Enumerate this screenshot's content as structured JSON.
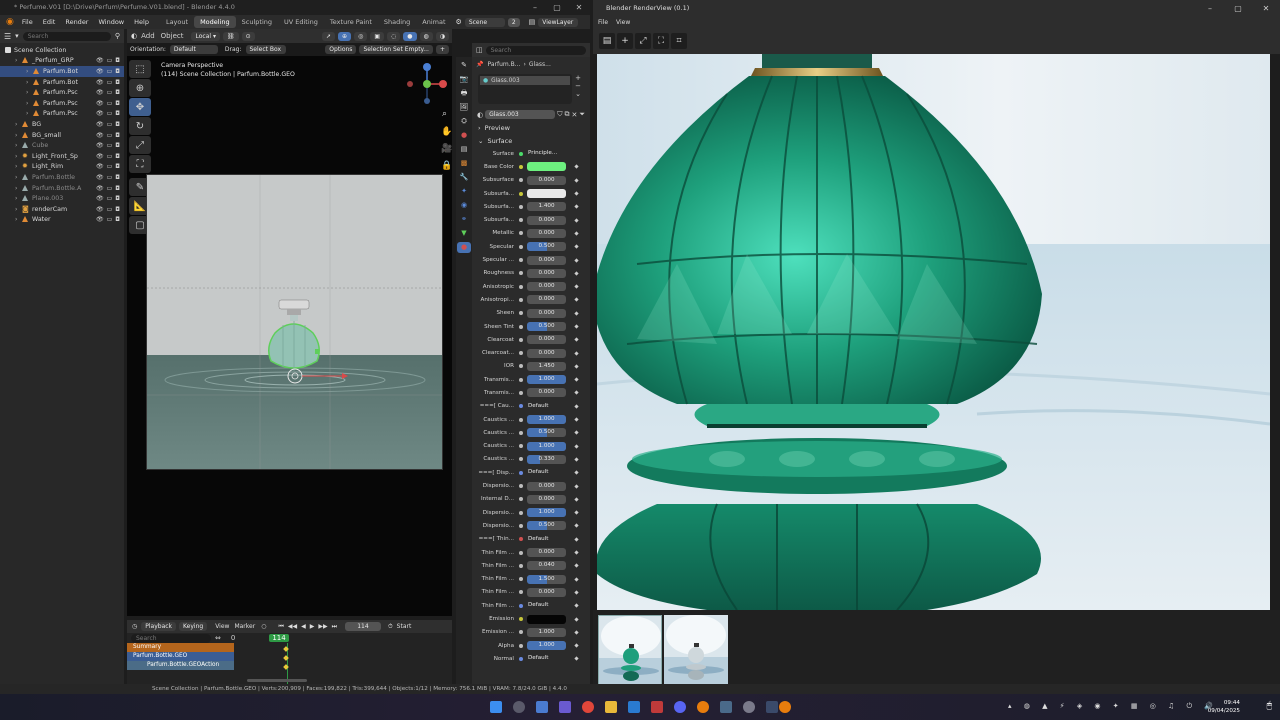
{
  "blender": {
    "title": "* Perfume.V01 [D:\\Drive\\Perfum\\Perfume.V01.blend] - Blender 4.4.0",
    "menus": [
      "File",
      "Edit",
      "Render",
      "Window",
      "Help"
    ],
    "workspaces": [
      "Layout",
      "Modeling",
      "Sculpting",
      "UV Editing",
      "Texture Paint",
      "Shading",
      "Animat"
    ],
    "active_workspace": "Modeling",
    "scene_label": "Scene",
    "view_layer_label": "ViewLayer",
    "scene_count": "2"
  },
  "outliner": {
    "search_placeholder": "Search",
    "root": "Scene Collection",
    "items": [
      {
        "label": "_Perfum_GRP",
        "indent": 1,
        "state": "normal",
        "icon": "empty"
      },
      {
        "label": "Parfum.Bot",
        "indent": 2,
        "state": "active",
        "icon": "mesh"
      },
      {
        "label": "Parfum.Bot",
        "indent": 2,
        "state": "normal",
        "icon": "mesh"
      },
      {
        "label": "Parfum.Psc",
        "indent": 2,
        "state": "normal",
        "icon": "mesh"
      },
      {
        "label": "Parfum.Psc",
        "indent": 2,
        "state": "normal",
        "icon": "mesh"
      },
      {
        "label": "Parfum.Psc",
        "indent": 2,
        "state": "normal",
        "icon": "mesh"
      },
      {
        "label": "BG",
        "indent": 1,
        "state": "normal",
        "icon": "mesh"
      },
      {
        "label": "BG_small",
        "indent": 1,
        "state": "normal",
        "icon": "mesh"
      },
      {
        "label": "Cube",
        "indent": 1,
        "state": "dim",
        "icon": "mesh"
      },
      {
        "label": "Light_Front_Sp",
        "indent": 1,
        "state": "normal",
        "icon": "light"
      },
      {
        "label": "Light_Rim",
        "indent": 1,
        "state": "normal",
        "icon": "light"
      },
      {
        "label": "Parfum.Bottle",
        "indent": 1,
        "state": "dim",
        "icon": "mesh"
      },
      {
        "label": "Parfum.Bottle.A",
        "indent": 1,
        "state": "dim",
        "icon": "mesh"
      },
      {
        "label": "Plane.003",
        "indent": 1,
        "state": "dim",
        "icon": "mesh"
      },
      {
        "label": "renderCam",
        "indent": 1,
        "state": "normal",
        "icon": "camera"
      },
      {
        "label": "Water",
        "indent": 1,
        "state": "normal",
        "icon": "mesh"
      }
    ]
  },
  "viewport": {
    "header": [
      "Add",
      "Object"
    ],
    "transform_space": "Local",
    "orientation_label": "Orientation:",
    "orientation_value": "Default",
    "drag_label": "Drag:",
    "drag_value": "Select Box",
    "options_label": "Options",
    "selection_set": "Selection Set Empty...",
    "info_line1": "Camera Perspective",
    "info_line2": "(114) Scene Collection | Parfum.Bottle.GEO"
  },
  "timeline": {
    "menus": [
      "Playback",
      "Keying",
      "View",
      "Marker"
    ],
    "current_frame": "114",
    "start_label": "Start",
    "frame_start": "0",
    "search_placeholder": "Search",
    "channels": [
      "Summary",
      "Parfum.Bottle.GEO",
      "Parfum.Bottle.GEOAction"
    ]
  },
  "properties": {
    "search_placeholder": "Search",
    "breadcrumb_object": "Parfum.B...",
    "breadcrumb_material": "Glass...",
    "material_slot": "Glass.003",
    "material_name": "Glass.003",
    "sections": {
      "preview": "Preview",
      "surface": "Surface"
    },
    "surface_label": "Surface",
    "surface_value": "Principle...",
    "rows": [
      {
        "label": "Base Color",
        "value": "",
        "kind": "color",
        "color": "#6df07f",
        "dot": "yellow"
      },
      {
        "label": "Subsurface",
        "value": "0.000",
        "kind": "num",
        "fill": 0
      },
      {
        "label": "Subsurfa...",
        "value": "",
        "kind": "color",
        "color": "#e8e8e8",
        "dot": "yellow"
      },
      {
        "label": "Subsurfa...",
        "value": "1.400",
        "kind": "num",
        "fill": 0
      },
      {
        "label": "Subsurfa...",
        "value": "0.000",
        "kind": "num",
        "fill": 0
      },
      {
        "label": "Metallic",
        "value": "0.000",
        "kind": "num",
        "fill": 0
      },
      {
        "label": "Specular",
        "value": "0.500",
        "kind": "num",
        "fill": 0.5
      },
      {
        "label": "Specular ...",
        "value": "0.000",
        "kind": "num",
        "fill": 0
      },
      {
        "label": "Roughness",
        "value": "0.000",
        "kind": "num",
        "fill": 0
      },
      {
        "label": "Anisotropic",
        "value": "0.000",
        "kind": "num",
        "fill": 0
      },
      {
        "label": "Anisotropi...",
        "value": "0.000",
        "kind": "num",
        "fill": 0
      },
      {
        "label": "Sheen",
        "value": "0.000",
        "kind": "num",
        "fill": 0
      },
      {
        "label": "Sheen Tint",
        "value": "0.500",
        "kind": "num",
        "fill": 0.5
      },
      {
        "label": "Clearcoat",
        "value": "0.000",
        "kind": "num",
        "fill": 0
      },
      {
        "label": "Clearcoat...",
        "value": "0.000",
        "kind": "num",
        "fill": 0
      },
      {
        "label": "IOR",
        "value": "1.450",
        "kind": "num",
        "fill": 0
      },
      {
        "label": "Transmis...",
        "value": "1.000",
        "kind": "num",
        "fill": 1
      },
      {
        "label": "Transmis...",
        "value": "0.000",
        "kind": "num",
        "fill": 0
      },
      {
        "label": "===[ Cau...",
        "value": "Default",
        "kind": "link",
        "dot": "blue"
      },
      {
        "label": "Caustics ...",
        "value": "1.000",
        "kind": "num",
        "fill": 1
      },
      {
        "label": "Caustics ...",
        "value": "0.500",
        "kind": "num",
        "fill": 0.5
      },
      {
        "label": "Caustics ...",
        "value": "1.000",
        "kind": "num",
        "fill": 1
      },
      {
        "label": "Caustics ...",
        "value": "0.330",
        "kind": "num",
        "fill": 0.33
      },
      {
        "label": "===[ Disp...",
        "value": "Default",
        "kind": "link",
        "dot": "blue"
      },
      {
        "label": "Dispersio...",
        "value": "0.000",
        "kind": "num",
        "fill": 0
      },
      {
        "label": "Internal D...",
        "value": "0.000",
        "kind": "num",
        "fill": 0
      },
      {
        "label": "Dispersio...",
        "value": "1.000",
        "kind": "num",
        "fill": 1
      },
      {
        "label": "Dispersio...",
        "value": "0.500",
        "kind": "num",
        "fill": 0.5
      },
      {
        "label": "===[ Thin...",
        "value": "Default",
        "kind": "link",
        "dot": "red"
      },
      {
        "label": "Thin Film ...",
        "value": "0.000",
        "kind": "num",
        "fill": 0
      },
      {
        "label": "Thin Film ...",
        "value": "0.040",
        "kind": "num",
        "fill": 0
      },
      {
        "label": "Thin Film ...",
        "value": "1.500",
        "kind": "num",
        "fill": 0.5
      },
      {
        "label": "Thin Film ...",
        "value": "0.000",
        "kind": "num",
        "fill": 0
      },
      {
        "label": "Thin Film ...",
        "value": "Default",
        "kind": "link",
        "dot": "blue"
      },
      {
        "label": "Emission",
        "value": "",
        "kind": "color",
        "color": "#050505",
        "dot": "yellow"
      },
      {
        "label": "Emission ...",
        "value": "1.000",
        "kind": "num",
        "fill": 0
      },
      {
        "label": "Alpha",
        "value": "1.000",
        "kind": "num",
        "fill": 1
      },
      {
        "label": "Normal",
        "value": "Default",
        "kind": "link",
        "dot": "blue"
      }
    ]
  },
  "status_bar": {
    "text": "Scene Collection | Parfum.Bottle.GEO | Verts:200,909 | Faces:199,822 | Tris:399,644 | Objects:1/12 | Memory: 756.1 MiB | VRAM: 7.8/24.0 GiB | 4.4.0"
  },
  "render_view": {
    "title": "Blender RenderView (0.1)",
    "menus": [
      "File",
      "View"
    ]
  },
  "taskbar": {
    "time": "09:44",
    "date": "09/04/2025"
  },
  "colors": {
    "accent": "#4772b3",
    "selection": "#334d80",
    "glass_green": "#1f9f7c",
    "outline_orange": "#e08a35"
  }
}
